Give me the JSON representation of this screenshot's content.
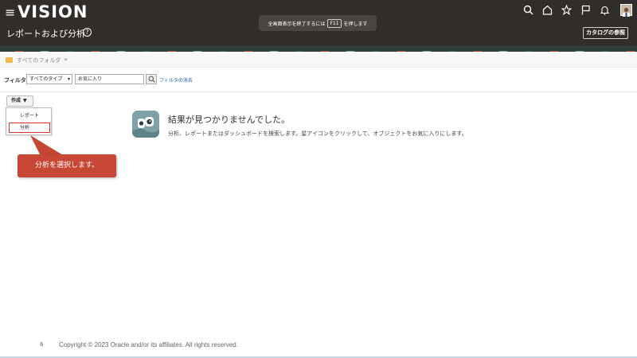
{
  "header": {
    "brand": "VISION",
    "page_title": "レポートおよび分析",
    "help_glyph": "?",
    "fullscreen_hint": {
      "prefix": "全画面表示を終了するには",
      "key": "F11",
      "suffix": "を押します"
    },
    "catalog_button": "カタログの参照",
    "icons": [
      "search-icon",
      "home-icon",
      "star-icon",
      "flag-icon",
      "bell-icon"
    ]
  },
  "breadcrumb": {
    "folder": "すべてのフォルダ",
    "separator": "»"
  },
  "filter": {
    "label": "フィルタ",
    "type_select": "すべてのタイプ",
    "favorites_value": "お気に入り",
    "clear_link": "フィルタの消去"
  },
  "create": {
    "button": "作成",
    "menu": [
      "レポート",
      "分析"
    ]
  },
  "callout": {
    "text": "分析を選択します。"
  },
  "empty_state": {
    "title": "結果が見つかりませんでした。",
    "description": "分析、レポートまたはダッシュボードを検索します。星アイコンをクリックして、オブジェクトをお気に入りにします。"
  },
  "footer": {
    "page_number": "6",
    "copyright": "Copyright © 2023 Oracle and/or its affiliates. All rights reserved."
  },
  "colors": {
    "header_bg": "#312d2a",
    "callout_bg": "#c74634",
    "highlight_border": "#d0342c",
    "link": "#1d5fa6"
  }
}
